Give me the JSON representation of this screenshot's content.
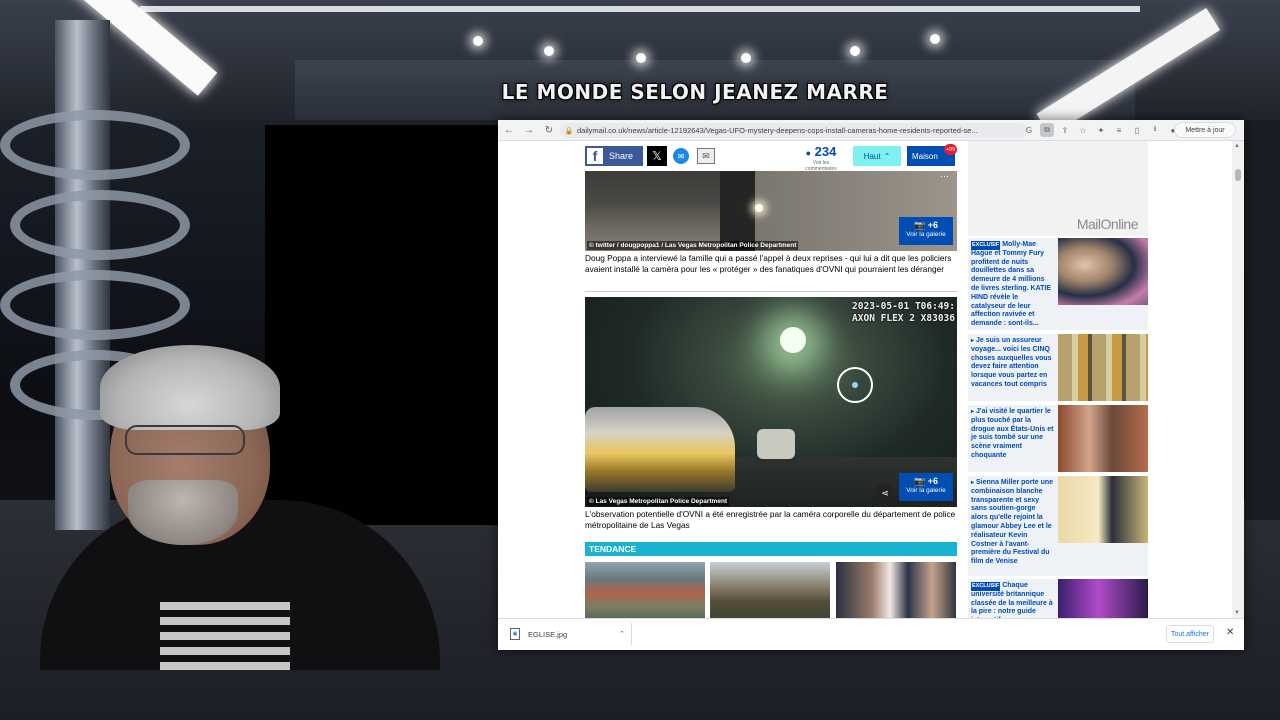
{
  "overlay": {
    "channel_title": "LE MONDE SELON JEANEZ MARRE"
  },
  "browser": {
    "url": "dailymail.co.uk/news/article-12192643/Vegas-UFO-mystery-deepens-cops-install-cameras-home-residents-reported-se...",
    "update_button": "Mettre à jour",
    "icons": [
      "back-icon",
      "forward-icon",
      "reload-icon",
      "lock-icon",
      "google-icon",
      "translate-icon",
      "share-icon",
      "star-icon",
      "extensions-icon",
      "reading-list-icon",
      "sidebar-icon",
      "download-icon",
      "profile-icon"
    ]
  },
  "share_bar": {
    "facebook_label": "Share",
    "x_label": "𝕏",
    "comment_count": "234",
    "comment_sub": "Voir les commentaires",
    "haut_label": "Haut",
    "maison_label": "Maison",
    "maison_badge": "+99"
  },
  "article": {
    "image1_credit": "© twitter / dougpoppa1 / Las Vegas Metropolitan Police Department",
    "image1_gallery_count": "+6",
    "image1_gallery_label": "Voir la galerie",
    "caption1": "Doug Poppa a interviewé la famille qui a passé l'appel à deux reprises - qui lui a dit que les policiers avaient installé la caméra pour les « protéger » des fanatiques d'OVNI qui pourraient les déranger",
    "image2_timestamp_line1": "2023-05-01 T06:49:",
    "image2_timestamp_line2": "AXON FLEX 2 X83036",
    "image2_credit": "© Las Vegas Metropolitan Police Department",
    "image2_gallery_count": "+6",
    "image2_gallery_label": "Voir la galerie",
    "caption2": "L'observation potentielle d'OVNI a été enregistrée par la caméra corporelle du département de police métropolitaine de Las Vegas",
    "tendance_label": "TENDANCE"
  },
  "sidebar": {
    "logo_mail": "Mail",
    "logo_online": "Online",
    "items": [
      {
        "tag": "EXCLUSIF",
        "text": "Molly-Mae Hague et Tommy Fury profitent de nuits douillettes dans sa demeure de 4 millions de livres sterling. KATIE HIND révèle le catalyseur de leur affection ravivée et demande : sont-ils..."
      },
      {
        "tag": "",
        "text": "Je suis un assureur voyage... voici les CINQ choses auxquelles vous devez faire attention lorsque vous partez en vacances tout compris"
      },
      {
        "tag": "",
        "text": "J'ai visité le quartier le plus touché par la drogue aux États-Unis et je suis tombé sur une scène vraiment choquante"
      },
      {
        "tag": "",
        "text": "Sienna Miller porte une combinaison blanche transparente et sexy sans soutien-gorge alors qu'elle rejoint la glamour Abbey Lee et le réalisateur Kevin Costner à l'avant-première du Festival du film de Venise"
      },
      {
        "tag": "EXCLUSIF",
        "text": "Chaque université britannique classée de la meilleure à la pire : notre guide interactif"
      }
    ]
  },
  "downloads": {
    "file_name": "EGLISE.jpg",
    "show_all": "Tout afficher"
  }
}
